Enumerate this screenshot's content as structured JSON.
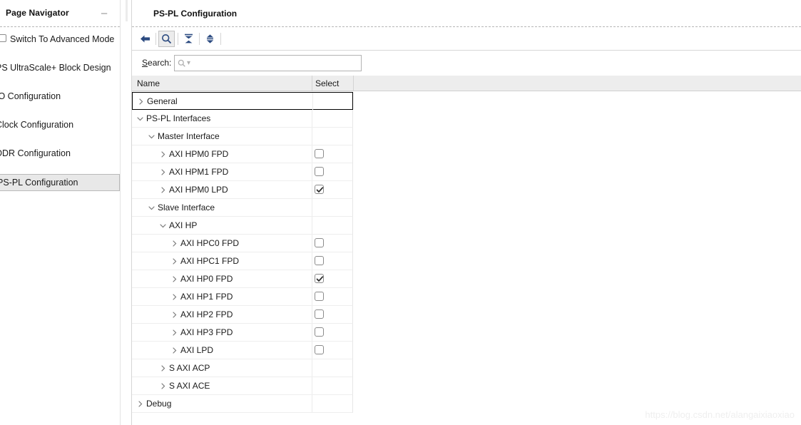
{
  "navigator": {
    "title": "Page Navigator",
    "minimize_label": "–",
    "items": [
      {
        "label": "Switch To Advanced Mode",
        "has_checkbox": true,
        "checked": false,
        "selected": false
      },
      {
        "label": "PS UltraScale+ Block Design",
        "has_checkbox": false,
        "checked": false,
        "selected": false
      },
      {
        "label": "/O Configuration",
        "has_checkbox": false,
        "checked": false,
        "selected": false
      },
      {
        "label": "Clock Configuration",
        "has_checkbox": false,
        "checked": false,
        "selected": false
      },
      {
        "label": "DDR Configuration",
        "has_checkbox": false,
        "checked": false,
        "selected": false
      },
      {
        "label": "PS-PL Configuration",
        "has_checkbox": false,
        "checked": false,
        "selected": true
      }
    ]
  },
  "panel": {
    "title": "PS-PL Configuration",
    "toolbar": {
      "buttons": [
        {
          "name": "back-arrow-icon",
          "tooltip": "Back",
          "active": false
        },
        {
          "name": "search-icon",
          "tooltip": "Search",
          "active": true
        },
        {
          "name": "collapse-all-icon",
          "tooltip": "Collapse All",
          "active": false
        },
        {
          "name": "expand-all-icon",
          "tooltip": "Expand All",
          "active": false
        }
      ]
    },
    "search": {
      "label_prefix": "S",
      "label_rest": "earch:",
      "value": "",
      "placeholder": ""
    },
    "table": {
      "columns": [
        "Name",
        "Select"
      ],
      "rows": [
        {
          "label": "General",
          "level": 1,
          "twisty": "right",
          "checkbox": null,
          "focused": true
        },
        {
          "label": "PS-PL Interfaces",
          "level": 1,
          "twisty": "down",
          "checkbox": null,
          "focused": false
        },
        {
          "label": "Master Interface",
          "level": 2,
          "twisty": "down",
          "checkbox": null,
          "focused": false
        },
        {
          "label": "AXI HPM0 FPD",
          "level": 3,
          "twisty": "right",
          "checkbox": false,
          "focused": false
        },
        {
          "label": "AXI HPM1 FPD",
          "level": 3,
          "twisty": "right",
          "checkbox": false,
          "focused": false
        },
        {
          "label": "AXI HPM0 LPD",
          "level": 3,
          "twisty": "right",
          "checkbox": true,
          "focused": false
        },
        {
          "label": "Slave Interface",
          "level": 2,
          "twisty": "down",
          "checkbox": null,
          "focused": false
        },
        {
          "label": "AXI HP",
          "level": 3,
          "twisty": "down",
          "checkbox": null,
          "focused": false
        },
        {
          "label": "AXI HPC0 FPD",
          "level": 4,
          "twisty": "right",
          "checkbox": false,
          "focused": false
        },
        {
          "label": "AXI HPC1 FPD",
          "level": 4,
          "twisty": "right",
          "checkbox": false,
          "focused": false
        },
        {
          "label": "AXI HP0 FPD",
          "level": 4,
          "twisty": "right",
          "checkbox": true,
          "focused": false
        },
        {
          "label": "AXI HP1 FPD",
          "level": 4,
          "twisty": "right",
          "checkbox": false,
          "focused": false
        },
        {
          "label": "AXI HP2 FPD",
          "level": 4,
          "twisty": "right",
          "checkbox": false,
          "focused": false
        },
        {
          "label": "AXI HP3 FPD",
          "level": 4,
          "twisty": "right",
          "checkbox": false,
          "focused": false
        },
        {
          "label": "AXI LPD",
          "level": 4,
          "twisty": "right",
          "checkbox": false,
          "focused": false
        },
        {
          "label": "S AXI ACP",
          "level": 3,
          "twisty": "right",
          "checkbox": null,
          "focused": false
        },
        {
          "label": "S AXI ACE",
          "level": 3,
          "twisty": "right",
          "checkbox": null,
          "focused": false
        },
        {
          "label": "Debug",
          "level": 1,
          "twisty": "right",
          "checkbox": null,
          "focused": false
        }
      ]
    }
  },
  "watermark": "https://blog.csdn.net/alangaixiaoxiao",
  "colors": {
    "icon_blue": "#2b4a80",
    "header_bg": "#ededed",
    "selected_bg": "#e8e8e8",
    "twisty_gray": "#7a7a7a"
  }
}
